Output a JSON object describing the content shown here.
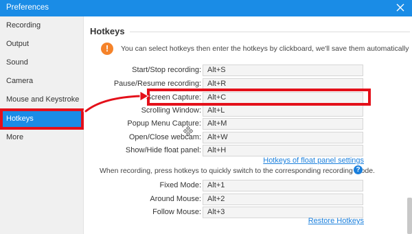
{
  "window": {
    "title": "Preferences"
  },
  "sidebar": {
    "items": [
      {
        "label": "Recording"
      },
      {
        "label": "Output"
      },
      {
        "label": "Sound"
      },
      {
        "label": "Camera"
      },
      {
        "label": "Mouse and Keystroke"
      },
      {
        "label": "Hotkeys",
        "active": true
      },
      {
        "label": "More"
      }
    ]
  },
  "hotkeys": {
    "title": "Hotkeys",
    "info_icon": "exclamation-icon",
    "info_text": "You can select hotkeys then enter the hotkeys by clickboard, we'll save them automatically",
    "rows": [
      {
        "label": "Start/Stop recording:",
        "value": "Alt+S"
      },
      {
        "label": "Pause/Resume recording:",
        "value": "Alt+R"
      },
      {
        "label": "Screen Capture:",
        "value": "Alt+C"
      },
      {
        "label": "Scrolling Window:",
        "value": "Alt+L"
      },
      {
        "label": "Popup Menu Capture:",
        "value": "Alt+M"
      },
      {
        "label": "Open/Close webcam:",
        "value": "Alt+W"
      },
      {
        "label": "Show/Hide float panel:",
        "value": "Alt+H"
      }
    ],
    "float_panel_link": "Hotkeys of float panel settings",
    "mode_text": "When recording, press hotkeys to quickly switch to the corresponding recording mode.",
    "mode_rows": [
      {
        "label": "Fixed Mode:",
        "value": "Alt+1"
      },
      {
        "label": "Around Mouse:",
        "value": "Alt+2"
      },
      {
        "label": "Follow Mouse:",
        "value": "Alt+3"
      }
    ],
    "restore_link": "Restore Hotkeys",
    "help_icon": "?"
  },
  "colors": {
    "accent": "#1a8ce6",
    "annotation": "#e4101a",
    "info": "#f5832a",
    "link": "#1a7fdc"
  }
}
